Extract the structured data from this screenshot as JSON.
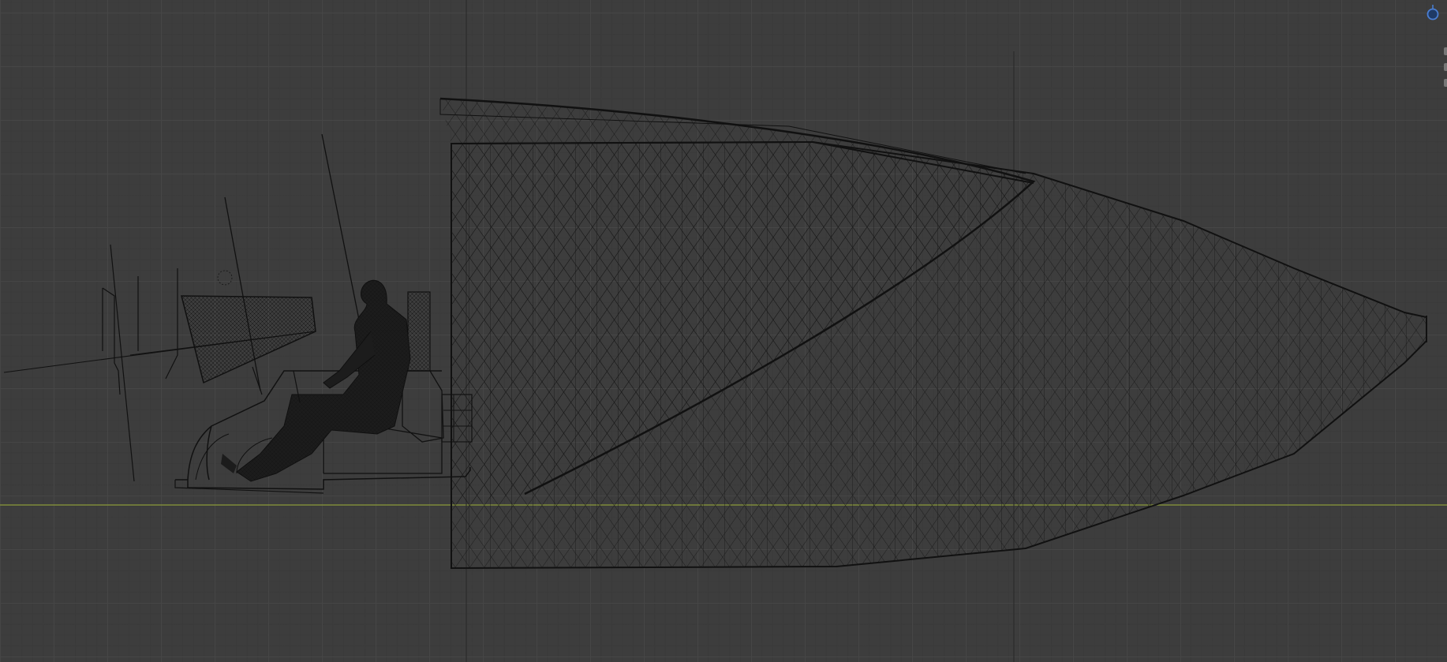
{
  "viewport": {
    "view": "orthographic-side",
    "colors": {
      "background": "#3d3d3d",
      "grid_major": "#464646",
      "grid_minor": "#3a3a3a",
      "axis_y": "#8a9a3a",
      "axis_z": "#2c2c2c",
      "wire": "#151515",
      "gizmo": "#4a7fd4"
    }
  },
  "objects": [
    {
      "name": "fuselage-nose-cone",
      "type": "wireframe-mesh"
    },
    {
      "name": "canopy-mesh",
      "type": "wireframe-mesh"
    },
    {
      "name": "pilot-figure",
      "type": "wireframe-mesh"
    },
    {
      "name": "ejection-seat",
      "type": "wireframe-mesh"
    },
    {
      "name": "instrument-panel",
      "type": "wireframe-mesh"
    },
    {
      "name": "cockpit-tub",
      "type": "wireframe-mesh"
    },
    {
      "name": "control-sticks",
      "type": "wireframe-mesh"
    }
  ],
  "nav_gizmo": {
    "icon": "view-navigation-gizmo-icon"
  }
}
